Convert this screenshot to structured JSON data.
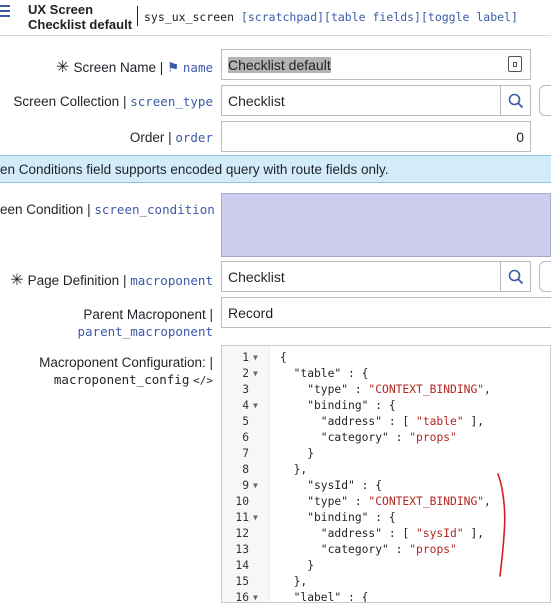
{
  "header": {
    "title_line1": "UX Screen",
    "title_line2": "Checklist default",
    "table_name": "sys_ux_screen",
    "tags": "[scratchpad][table fields][toggle label]"
  },
  "form": {
    "screen_name": {
      "label": "Screen Name",
      "api": "name",
      "value": "Checklist default"
    },
    "screen_collection": {
      "label": "Screen Collection",
      "api": "screen_type",
      "value": "Checklist"
    },
    "order": {
      "label": "Order",
      "api": "order",
      "value": "0"
    },
    "info_message": "en Conditions field supports encoded query with route fields only.",
    "screen_condition": {
      "label": "een Condition",
      "api": "screen_condition"
    },
    "page_definition": {
      "label": "Page Definition",
      "api": "macroponent",
      "value": "Checklist"
    },
    "parent_macroponent": {
      "label": "Parent Macroponent",
      "api": "parent_macroponent",
      "value": "Record"
    },
    "macroponent_config": {
      "label": "Macroponent Configuration:",
      "api": "macroponent_config"
    }
  },
  "code_lines": [
    {
      "n": "1",
      "fold": true,
      "text": "{"
    },
    {
      "n": "2",
      "fold": true,
      "text": "  \"table\" : {"
    },
    {
      "n": "3",
      "fold": false,
      "text": "    \"type\" : \"CONTEXT_BINDING\","
    },
    {
      "n": "4",
      "fold": true,
      "text": "    \"binding\" : {"
    },
    {
      "n": "5",
      "fold": false,
      "text": "      \"address\" : [ \"table\" ],"
    },
    {
      "n": "6",
      "fold": false,
      "text": "      \"category\" : \"props\""
    },
    {
      "n": "7",
      "fold": false,
      "text": "    }"
    },
    {
      "n": "8",
      "fold": false,
      "text": "  },"
    },
    {
      "n": "9",
      "fold": true,
      "text": "    \"sysId\" : {"
    },
    {
      "n": "10",
      "fold": false,
      "text": "    \"type\" : \"CONTEXT_BINDING\","
    },
    {
      "n": "11",
      "fold": true,
      "text": "    \"binding\" : {"
    },
    {
      "n": "12",
      "fold": false,
      "text": "      \"address\" : [ \"sysId\" ],"
    },
    {
      "n": "13",
      "fold": false,
      "text": "      \"category\" : \"props\""
    },
    {
      "n": "14",
      "fold": false,
      "text": "    }"
    },
    {
      "n": "15",
      "fold": false,
      "text": "  },"
    },
    {
      "n": "16",
      "fold": true,
      "text": "  \"label\" : {"
    }
  ],
  "colors": {
    "accent": "#3d5aa8",
    "info_bg": "#d3ecf9",
    "condition_bg": "#ccccee",
    "annotation": "#d42020"
  }
}
